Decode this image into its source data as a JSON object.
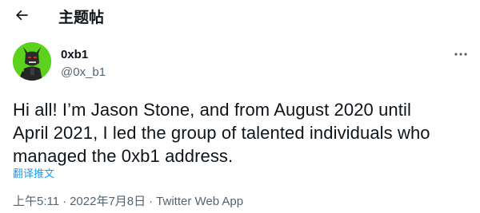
{
  "header": {
    "title": "主题帖"
  },
  "author": {
    "display_name": "0xb1",
    "handle": "@0x_b1"
  },
  "tweet": {
    "lines": [
      "Hi all! I’m Jason Stone, and from August 2020 until",
      "April 2021, I led the group of talented individuals who",
      "managed the 0xb1 address."
    ],
    "translate_label": "翻译推文"
  },
  "meta": {
    "time": "上午5:11",
    "separator": "·",
    "date": "2022年7月8日",
    "source": "Twitter Web App"
  },
  "colors": {
    "text": "#0f1419",
    "secondary": "#536471",
    "link": "#1d9bf0",
    "avatar_bg": "#5ad21e"
  }
}
